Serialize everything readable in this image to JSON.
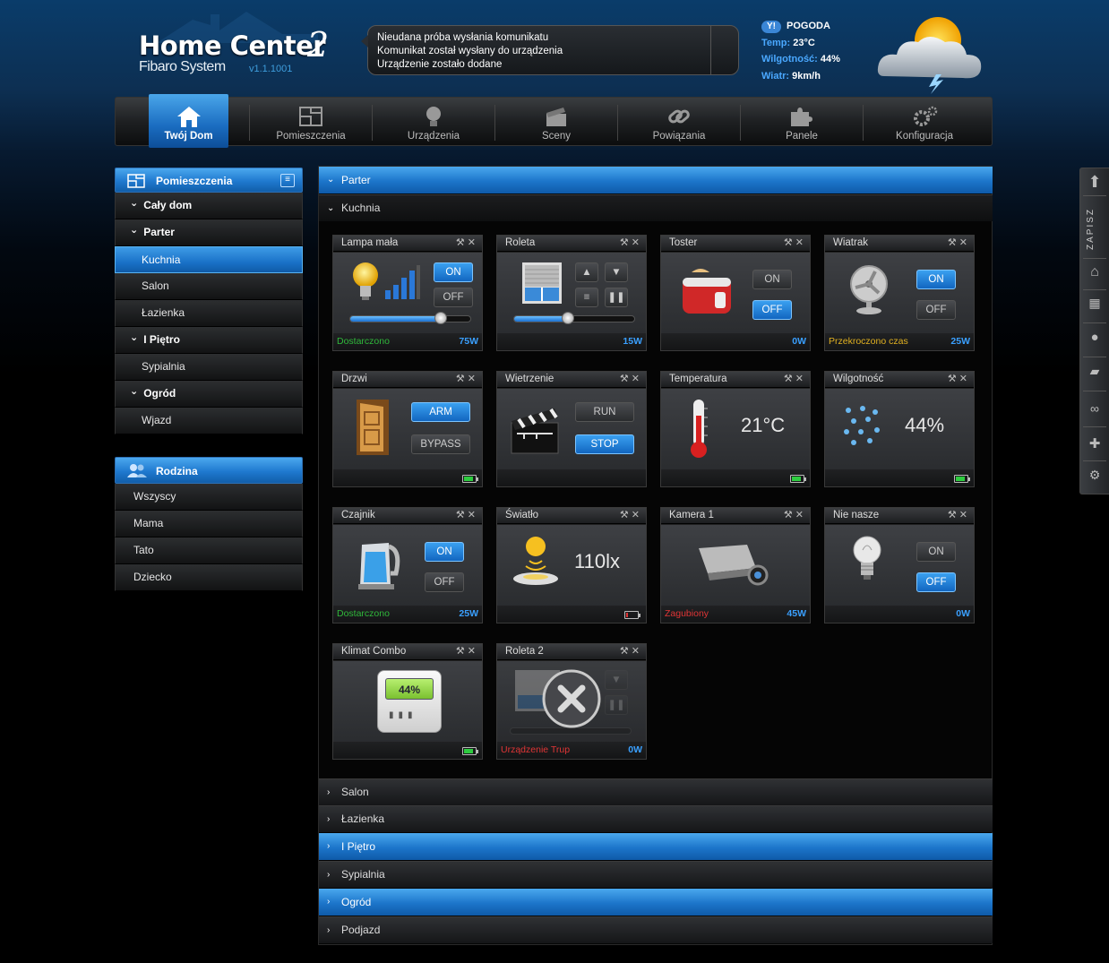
{
  "header": {
    "logo_title": "Home Center",
    "logo_two": "2",
    "logo_sub": "Fibaro System",
    "version": "v1.1.1001",
    "messages": [
      "Nieudana próba wysłania komunikatu",
      "Komunikat został wysłany do urządzenia",
      "Urządzenie zostało dodane"
    ],
    "weather": {
      "title": "POGODA",
      "temp_label": "Temp:",
      "temp_value": "23°C",
      "humidity_label": "Wilgotność:",
      "humidity_value": "44%",
      "wind_label": "Wiatr:",
      "wind_value": "9km/h",
      "icon": "cloudy-storm-sun-icon"
    }
  },
  "nav": [
    {
      "label": "Twój Dom",
      "icon": "home-icon",
      "active": true
    },
    {
      "label": "Pomieszczenia",
      "icon": "rooms-icon"
    },
    {
      "label": "Urządzenia",
      "icon": "lightbulb-icon"
    },
    {
      "label": "Sceny",
      "icon": "clapper-icon"
    },
    {
      "label": "Powiązania",
      "icon": "link-icon"
    },
    {
      "label": "Panele",
      "icon": "puzzle-icon"
    },
    {
      "label": "Konfiguracja",
      "icon": "gears-icon"
    }
  ],
  "sidebar_rooms": {
    "title": "Pomieszczenia",
    "items": [
      {
        "label": "Cały dom",
        "level": 1
      },
      {
        "label": "Parter",
        "level": 1
      },
      {
        "label": "Kuchnia",
        "level": 2,
        "selected": true
      },
      {
        "label": "Salon",
        "level": 2
      },
      {
        "label": "Łazienka",
        "level": 2
      },
      {
        "label": "I Piętro",
        "level": 1
      },
      {
        "label": "Sypialnia",
        "level": 2
      },
      {
        "label": "Ogród",
        "level": 1
      },
      {
        "label": "Wjazd",
        "level": 2
      }
    ]
  },
  "sidebar_family": {
    "title": "Rodzina",
    "items": [
      "Wszyscy",
      "Mama",
      "Tato",
      "Dziecko"
    ]
  },
  "main": {
    "section_top": "Parter",
    "subsection": "Kuchnia",
    "sections_bottom": [
      {
        "label": "Salon",
        "blue": false
      },
      {
        "label": "Łazienka",
        "blue": false
      },
      {
        "label": "I Piętro",
        "blue": true
      },
      {
        "label": "Sypialnia",
        "blue": false
      },
      {
        "label": "Ogród",
        "blue": true
      },
      {
        "label": "Podjazd",
        "blue": false
      }
    ]
  },
  "devices": {
    "lampa": {
      "name": "Lampa mała",
      "on": "ON",
      "off": "OFF",
      "status": "Dostarczono",
      "power": "75W",
      "level": 0.75
    },
    "roleta": {
      "name": "Roleta",
      "power": "15W",
      "level": 0.45
    },
    "toster": {
      "name": "Toster",
      "on": "ON",
      "off": "OFF",
      "power": "0W"
    },
    "wiatrak": {
      "name": "Wiatrak",
      "on": "ON",
      "off": "OFF",
      "status": "Przekroczono czas",
      "power": "25W"
    },
    "drzwi": {
      "name": "Drzwi",
      "arm": "ARM",
      "bypass": "BYPASS",
      "battery": 0.8
    },
    "wietrzenie": {
      "name": "Wietrzenie",
      "run": "RUN",
      "stop": "STOP"
    },
    "temperatura": {
      "name": "Temperatura",
      "value": "21°C",
      "battery": 0.8
    },
    "wilgotnosc": {
      "name": "Wilgotność",
      "value": "44%",
      "battery": 0.8
    },
    "czajnik": {
      "name": "Czajnik",
      "on": "ON",
      "off": "OFF",
      "status": "Dostarczono",
      "power": "25W"
    },
    "swiatlo": {
      "name": "Światło",
      "value": "110lx",
      "battery": 0.15
    },
    "kamera": {
      "name": "Kamera 1",
      "status": "Zagubiony",
      "power": "45W"
    },
    "nienasze": {
      "name": "Nie nasze",
      "on": "ON",
      "off": "OFF",
      "power": "0W"
    },
    "klimat": {
      "name": "Klimat Combo",
      "display": "44%",
      "battery": 0.8
    },
    "roleta2": {
      "name": "Roleta 2",
      "status": "Urządzenie Trup",
      "power": "0W"
    }
  },
  "right_panel": {
    "save_label": "ZAPISZ"
  },
  "colors": {
    "accent": "#1f79cf",
    "status_green": "#2fb83a",
    "status_yellow": "#e0b020",
    "status_red": "#e03535",
    "power_blue": "#3aa0ff"
  }
}
